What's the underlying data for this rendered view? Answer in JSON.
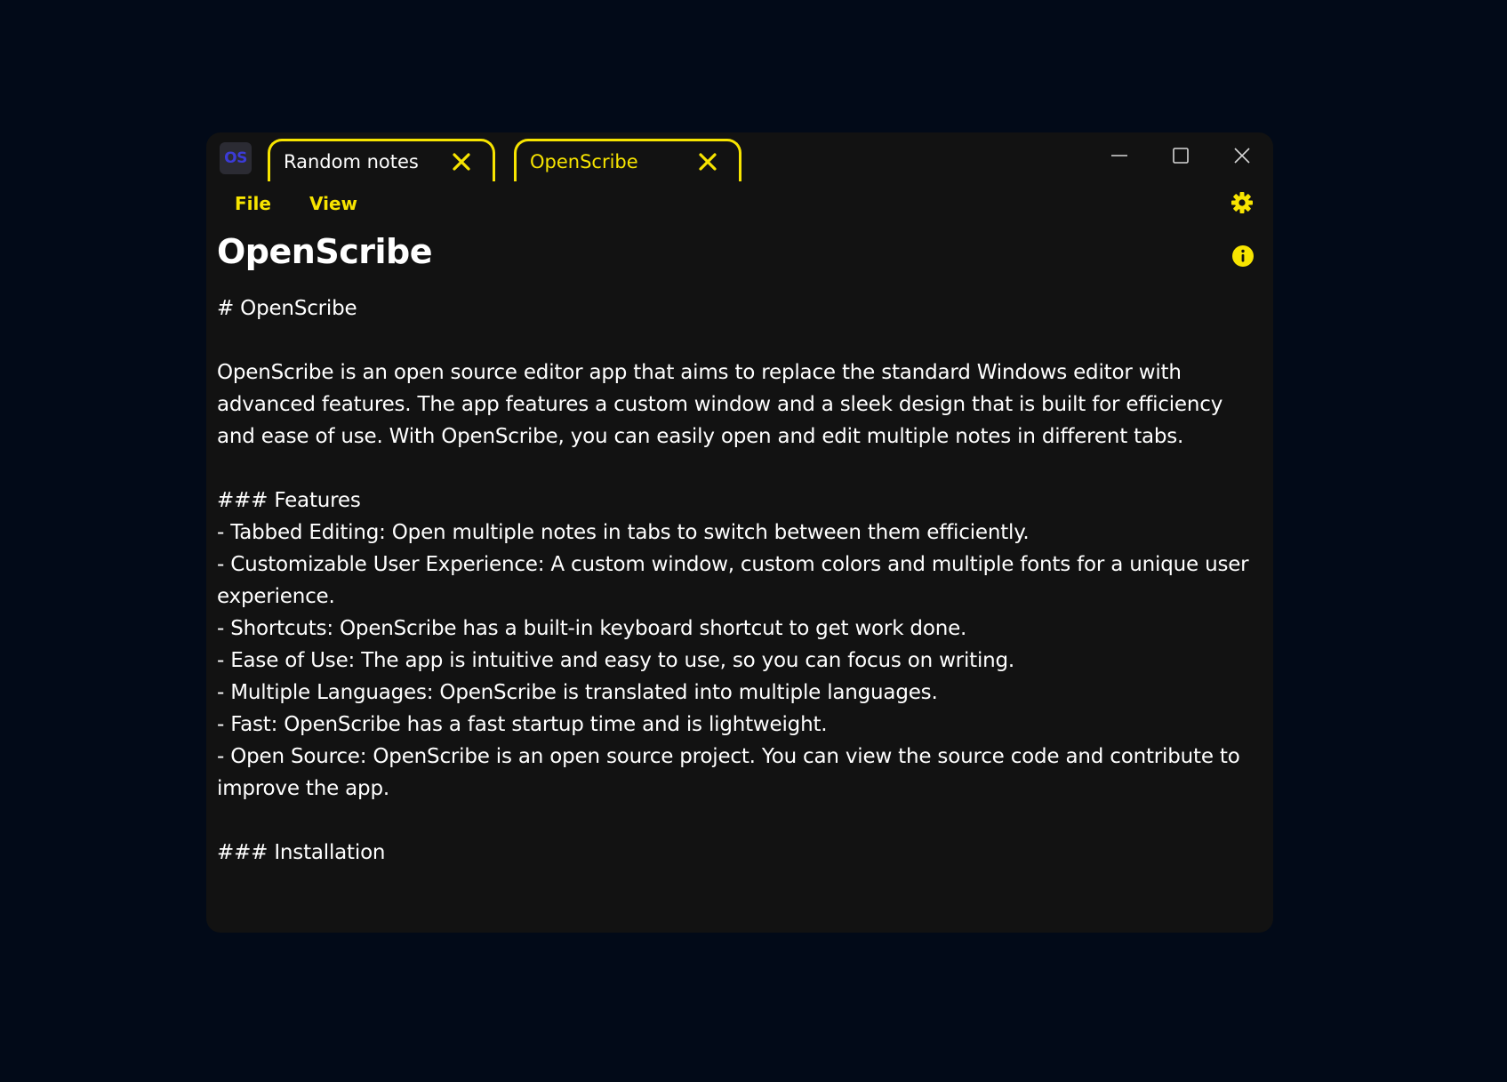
{
  "app": {
    "logo_text": "OS",
    "accent_color": "#f7e400",
    "logo_color": "#3b3bd6"
  },
  "tabs": [
    {
      "label": "Random notes",
      "active": false,
      "close_icon": "close-x-icon"
    },
    {
      "label": "OpenScribe",
      "active": true,
      "close_icon": "close-x-icon"
    }
  ],
  "window_controls": {
    "minimize_icon": "minimize-icon",
    "maximize_icon": "maximize-icon",
    "close_icon": "close-icon"
  },
  "menu": {
    "file_label": "File",
    "view_label": "View",
    "settings_icon": "gear-icon"
  },
  "document": {
    "title": "OpenScribe",
    "info_icon": "info-icon",
    "content": "# OpenScribe\n\nOpenScribe is an open source editor app that aims to replace the standard Windows editor with advanced features. The app features a custom window and a sleek design that is built for efficiency and ease of use. With OpenScribe, you can easily open and edit multiple notes in different tabs.\n\n### Features\n- Tabbed Editing: Open multiple notes in tabs to switch between them efficiently.\n- Customizable User Experience: A custom window, custom colors and multiple fonts for a unique user experience.\n- Shortcuts: OpenScribe has a built-in keyboard shortcut to get work done.\n- Ease of Use: The app is intuitive and easy to use, so you can focus on writing.\n- Multiple Languages: OpenScribe is translated into multiple languages.\n- Fast: OpenScribe has a fast startup time and is lightweight.\n- Open Source: OpenScribe is an open source project. You can view the source code and contribute to improve the app.\n\n### Installation"
  }
}
